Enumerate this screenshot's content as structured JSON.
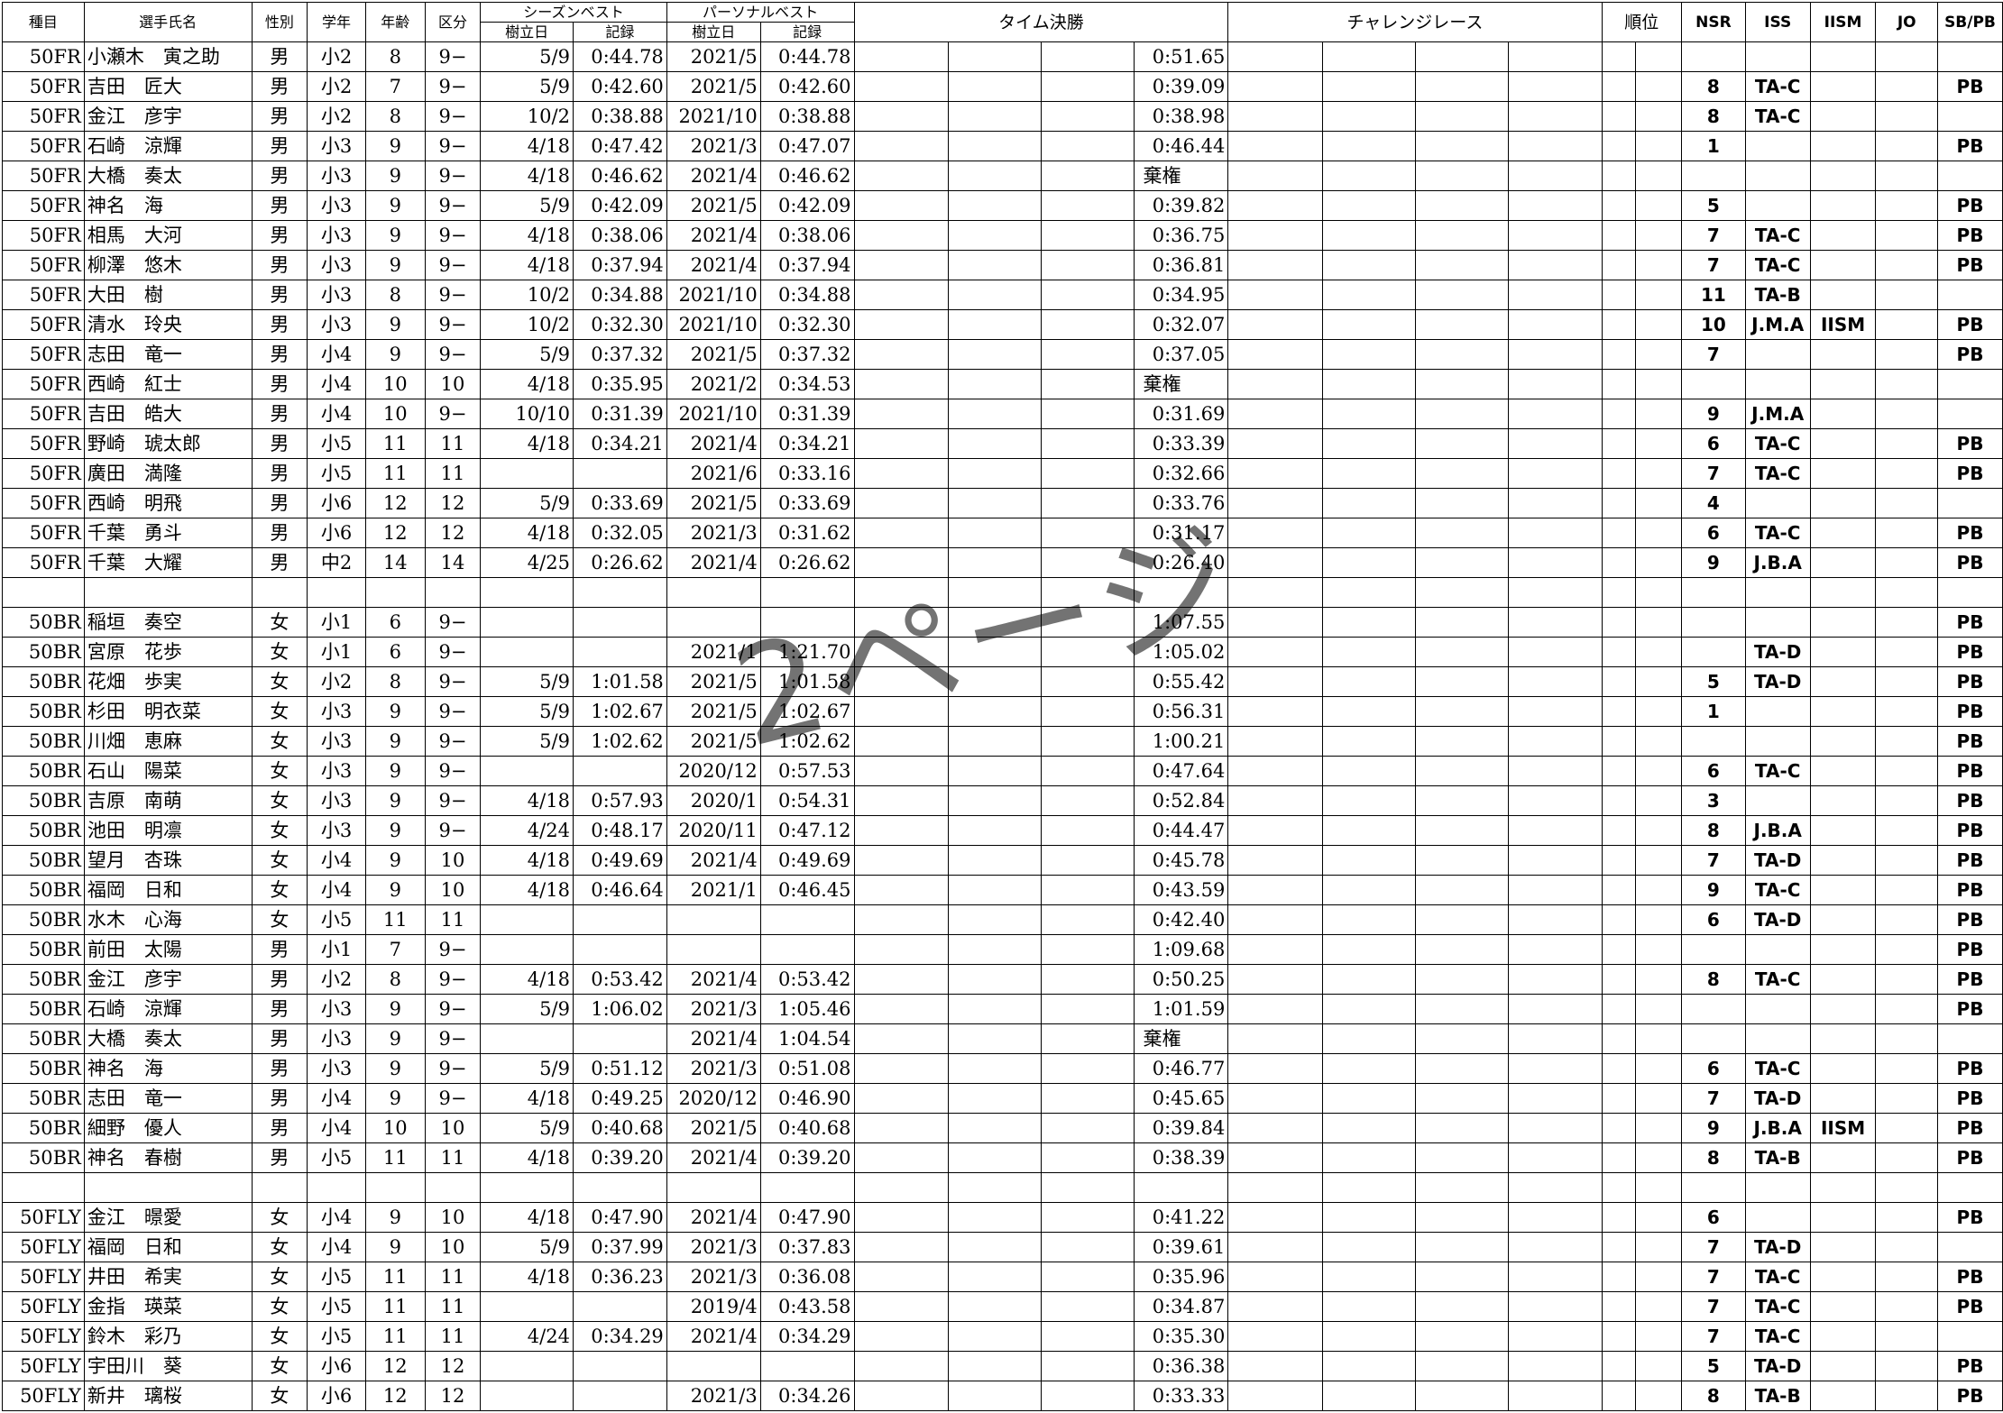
{
  "headers": {
    "event": "種目",
    "name": "選手氏名",
    "gender": "性別",
    "grade": "学年",
    "age": "年齢",
    "division": "区分",
    "season_best": "シーズンベスト",
    "personal_best": "パーソナルベスト",
    "date_set": "樹立日",
    "record": "記録",
    "time_final": "タイム決勝",
    "challenge_race": "チャレンジレース",
    "rank": "順位",
    "nsr": "NSR",
    "iss": "ISS",
    "iism": "IISM",
    "jo": "JO",
    "sbpb": "SB/PB"
  },
  "watermark": "2ページ",
  "rows": [
    {
      "event": "50FR",
      "name": "小瀬木　寅之助",
      "gender": "男",
      "grade": "小2",
      "age": "8",
      "div": "9−",
      "sb_date": "5/9",
      "sb": "0:44.78",
      "pb_date": "2021/5",
      "pb": "0:44.78",
      "final": "0:51.65",
      "nsr": "",
      "iss": "",
      "iism": "",
      "jo": "",
      "sbpb": ""
    },
    {
      "event": "50FR",
      "name": "吉田　匠大",
      "gender": "男",
      "grade": "小2",
      "age": "7",
      "div": "9−",
      "sb_date": "5/9",
      "sb": "0:42.60",
      "pb_date": "2021/5",
      "pb": "0:42.60",
      "final": "0:39.09",
      "nsr": "8",
      "iss": "TA-C",
      "iism": "",
      "jo": "",
      "sbpb": "PB"
    },
    {
      "event": "50FR",
      "name": "金江　彦宇",
      "gender": "男",
      "grade": "小2",
      "age": "8",
      "div": "9−",
      "sb_date": "10/2",
      "sb": "0:38.88",
      "pb_date": "2021/10",
      "pb": "0:38.88",
      "final": "0:38.98",
      "nsr": "8",
      "iss": "TA-C",
      "iism": "",
      "jo": "",
      "sbpb": ""
    },
    {
      "event": "50FR",
      "name": "石崎　涼輝",
      "gender": "男",
      "grade": "小3",
      "age": "9",
      "div": "9−",
      "sb_date": "4/18",
      "sb": "0:47.42",
      "pb_date": "2021/3",
      "pb": "0:47.07",
      "final": "0:46.44",
      "nsr": "1",
      "iss": "",
      "iism": "",
      "jo": "",
      "sbpb": "PB"
    },
    {
      "event": "50FR",
      "name": "大橋　奏太",
      "gender": "男",
      "grade": "小3",
      "age": "9",
      "div": "9−",
      "sb_date": "4/18",
      "sb": "0:46.62",
      "pb_date": "2021/4",
      "pb": "0:46.62",
      "final": "",
      "note": "棄権",
      "nsr": "",
      "iss": "",
      "iism": "",
      "jo": "",
      "sbpb": ""
    },
    {
      "event": "50FR",
      "name": "神名　海",
      "gender": "男",
      "grade": "小3",
      "age": "9",
      "div": "9−",
      "sb_date": "5/9",
      "sb": "0:42.09",
      "pb_date": "2021/5",
      "pb": "0:42.09",
      "final": "0:39.82",
      "nsr": "5",
      "iss": "",
      "iism": "",
      "jo": "",
      "sbpb": "PB"
    },
    {
      "event": "50FR",
      "name": "相馬　大河",
      "gender": "男",
      "grade": "小3",
      "age": "9",
      "div": "9−",
      "sb_date": "4/18",
      "sb": "0:38.06",
      "pb_date": "2021/4",
      "pb": "0:38.06",
      "final": "0:36.75",
      "nsr": "7",
      "iss": "TA-C",
      "iism": "",
      "jo": "",
      "sbpb": "PB"
    },
    {
      "event": "50FR",
      "name": "柳澤　悠木",
      "gender": "男",
      "grade": "小3",
      "age": "9",
      "div": "9−",
      "sb_date": "4/18",
      "sb": "0:37.94",
      "pb_date": "2021/4",
      "pb": "0:37.94",
      "final": "0:36.81",
      "nsr": "7",
      "iss": "TA-C",
      "iism": "",
      "jo": "",
      "sbpb": "PB"
    },
    {
      "event": "50FR",
      "name": "大田　樹",
      "gender": "男",
      "grade": "小3",
      "age": "8",
      "div": "9−",
      "sb_date": "10/2",
      "sb": "0:34.88",
      "pb_date": "2021/10",
      "pb": "0:34.88",
      "final": "0:34.95",
      "nsr": "11",
      "iss": "TA-B",
      "iism": "",
      "jo": "",
      "sbpb": ""
    },
    {
      "event": "50FR",
      "name": "清水　玲央",
      "gender": "男",
      "grade": "小3",
      "age": "9",
      "div": "9−",
      "sb_date": "10/2",
      "sb": "0:32.30",
      "pb_date": "2021/10",
      "pb": "0:32.30",
      "final": "0:32.07",
      "nsr": "10",
      "iss": "J.M.A",
      "iism": "IISM",
      "jo": "",
      "sbpb": "PB"
    },
    {
      "event": "50FR",
      "name": "志田　竜一",
      "gender": "男",
      "grade": "小4",
      "age": "9",
      "div": "9−",
      "sb_date": "5/9",
      "sb": "0:37.32",
      "pb_date": "2021/5",
      "pb": "0:37.32",
      "final": "0:37.05",
      "nsr": "7",
      "iss": "",
      "iism": "",
      "jo": "",
      "sbpb": "PB"
    },
    {
      "event": "50FR",
      "name": "西崎　紅士",
      "gender": "男",
      "grade": "小4",
      "age": "10",
      "div": "10",
      "sb_date": "4/18",
      "sb": "0:35.95",
      "pb_date": "2021/2",
      "pb": "0:34.53",
      "final": "",
      "note": "棄権",
      "nsr": "",
      "iss": "",
      "iism": "",
      "jo": "",
      "sbpb": ""
    },
    {
      "event": "50FR",
      "name": "吉田　皓大",
      "gender": "男",
      "grade": "小4",
      "age": "10",
      "div": "9−",
      "sb_date": "10/10",
      "sb": "0:31.39",
      "pb_date": "2021/10",
      "pb": "0:31.39",
      "final": "0:31.69",
      "nsr": "9",
      "iss": "J.M.A",
      "iism": "",
      "jo": "",
      "sbpb": ""
    },
    {
      "event": "50FR",
      "name": "野崎　琥太郎",
      "gender": "男",
      "grade": "小5",
      "age": "11",
      "div": "11",
      "sb_date": "4/18",
      "sb": "0:34.21",
      "pb_date": "2021/4",
      "pb": "0:34.21",
      "final": "0:33.39",
      "nsr": "6",
      "iss": "TA-C",
      "iism": "",
      "jo": "",
      "sbpb": "PB"
    },
    {
      "event": "50FR",
      "name": "廣田　満隆",
      "gender": "男",
      "grade": "小5",
      "age": "11",
      "div": "11",
      "sb_date": "",
      "sb": "",
      "pb_date": "2021/6",
      "pb": "0:33.16",
      "final": "0:32.66",
      "nsr": "7",
      "iss": "TA-C",
      "iism": "",
      "jo": "",
      "sbpb": "PB"
    },
    {
      "event": "50FR",
      "name": "西崎　明飛",
      "gender": "男",
      "grade": "小6",
      "age": "12",
      "div": "12",
      "sb_date": "5/9",
      "sb": "0:33.69",
      "pb_date": "2021/5",
      "pb": "0:33.69",
      "final": "0:33.76",
      "nsr": "4",
      "iss": "",
      "iism": "",
      "jo": "",
      "sbpb": ""
    },
    {
      "event": "50FR",
      "name": "千葉　勇斗",
      "gender": "男",
      "grade": "小6",
      "age": "12",
      "div": "12",
      "sb_date": "4/18",
      "sb": "0:32.05",
      "pb_date": "2021/3",
      "pb": "0:31.62",
      "final": "0:31.17",
      "nsr": "6",
      "iss": "TA-C",
      "iism": "",
      "jo": "",
      "sbpb": "PB"
    },
    {
      "event": "50FR",
      "name": "千葉　大耀",
      "gender": "男",
      "grade": "中2",
      "age": "14",
      "div": "14",
      "sb_date": "4/25",
      "sb": "0:26.62",
      "pb_date": "2021/4",
      "pb": "0:26.62",
      "final": "0:26.40",
      "nsr": "9",
      "iss": "J.B.A",
      "iism": "",
      "jo": "",
      "sbpb": "PB"
    },
    {
      "blank": true
    },
    {
      "event": "50BR",
      "name": "稲垣　奏空",
      "gender": "女",
      "grade": "小1",
      "age": "6",
      "div": "9−",
      "sb_date": "",
      "sb": "",
      "pb_date": "",
      "pb": "",
      "final": "1:07.55",
      "nsr": "",
      "iss": "",
      "iism": "",
      "jo": "",
      "sbpb": "PB"
    },
    {
      "event": "50BR",
      "name": "宮原　花歩",
      "gender": "女",
      "grade": "小1",
      "age": "6",
      "div": "9−",
      "sb_date": "",
      "sb": "",
      "pb_date": "2021/1",
      "pb": "1:21.70",
      "final": "1:05.02",
      "nsr": "",
      "iss": "TA-D",
      "iism": "",
      "jo": "",
      "sbpb": "PB"
    },
    {
      "event": "50BR",
      "name": "花畑　歩実",
      "gender": "女",
      "grade": "小2",
      "age": "8",
      "div": "9−",
      "sb_date": "5/9",
      "sb": "1:01.58",
      "pb_date": "2021/5",
      "pb": "1:01.58",
      "final": "0:55.42",
      "nsr": "5",
      "iss": "TA-D",
      "iism": "",
      "jo": "",
      "sbpb": "PB"
    },
    {
      "event": "50BR",
      "name": "杉田　明衣菜",
      "gender": "女",
      "grade": "小3",
      "age": "9",
      "div": "9−",
      "sb_date": "5/9",
      "sb": "1:02.67",
      "pb_date": "2021/5",
      "pb": "1:02.67",
      "final": "0:56.31",
      "nsr": "1",
      "iss": "",
      "iism": "",
      "jo": "",
      "sbpb": "PB"
    },
    {
      "event": "50BR",
      "name": "川畑　恵麻",
      "gender": "女",
      "grade": "小3",
      "age": "9",
      "div": "9−",
      "sb_date": "5/9",
      "sb": "1:02.62",
      "pb_date": "2021/5",
      "pb": "1:02.62",
      "final": "1:00.21",
      "nsr": "",
      "iss": "",
      "iism": "",
      "jo": "",
      "sbpb": "PB"
    },
    {
      "event": "50BR",
      "name": "石山　陽菜",
      "gender": "女",
      "grade": "小3",
      "age": "9",
      "div": "9−",
      "sb_date": "",
      "sb": "",
      "pb_date": "2020/12",
      "pb": "0:57.53",
      "final": "0:47.64",
      "nsr": "6",
      "iss": "TA-C",
      "iism": "",
      "jo": "",
      "sbpb": "PB"
    },
    {
      "event": "50BR",
      "name": "吉原　南萌",
      "gender": "女",
      "grade": "小3",
      "age": "9",
      "div": "9−",
      "sb_date": "4/18",
      "sb": "0:57.93",
      "pb_date": "2020/1",
      "pb": "0:54.31",
      "final": "0:52.84",
      "nsr": "3",
      "iss": "",
      "iism": "",
      "jo": "",
      "sbpb": "PB"
    },
    {
      "event": "50BR",
      "name": "池田　明凛",
      "gender": "女",
      "grade": "小3",
      "age": "9",
      "div": "9−",
      "sb_date": "4/24",
      "sb": "0:48.17",
      "pb_date": "2020/11",
      "pb": "0:47.12",
      "final": "0:44.47",
      "nsr": "8",
      "iss": "J.B.A",
      "iism": "",
      "jo": "",
      "sbpb": "PB"
    },
    {
      "event": "50BR",
      "name": "望月　杏珠",
      "gender": "女",
      "grade": "小4",
      "age": "9",
      "div": "10",
      "sb_date": "4/18",
      "sb": "0:49.69",
      "pb_date": "2021/4",
      "pb": "0:49.69",
      "final": "0:45.78",
      "nsr": "7",
      "iss": "TA-D",
      "iism": "",
      "jo": "",
      "sbpb": "PB"
    },
    {
      "event": "50BR",
      "name": "福岡　日和",
      "gender": "女",
      "grade": "小4",
      "age": "9",
      "div": "10",
      "sb_date": "4/18",
      "sb": "0:46.64",
      "pb_date": "2021/1",
      "pb": "0:46.45",
      "final": "0:43.59",
      "nsr": "9",
      "iss": "TA-C",
      "iism": "",
      "jo": "",
      "sbpb": "PB"
    },
    {
      "event": "50BR",
      "name": "水木　心海",
      "gender": "女",
      "grade": "小5",
      "age": "11",
      "div": "11",
      "sb_date": "",
      "sb": "",
      "pb_date": "",
      "pb": "",
      "final": "0:42.40",
      "nsr": "6",
      "iss": "TA-D",
      "iism": "",
      "jo": "",
      "sbpb": "PB"
    },
    {
      "event": "50BR",
      "name": "前田　太陽",
      "gender": "男",
      "grade": "小1",
      "age": "7",
      "div": "9−",
      "sb_date": "",
      "sb": "",
      "pb_date": "",
      "pb": "",
      "final": "1:09.68",
      "nsr": "",
      "iss": "",
      "iism": "",
      "jo": "",
      "sbpb": "PB"
    },
    {
      "event": "50BR",
      "name": "金江　彦宇",
      "gender": "男",
      "grade": "小2",
      "age": "8",
      "div": "9−",
      "sb_date": "4/18",
      "sb": "0:53.42",
      "pb_date": "2021/4",
      "pb": "0:53.42",
      "final": "0:50.25",
      "nsr": "8",
      "iss": "TA-C",
      "iism": "",
      "jo": "",
      "sbpb": "PB"
    },
    {
      "event": "50BR",
      "name": "石崎　涼輝",
      "gender": "男",
      "grade": "小3",
      "age": "9",
      "div": "9−",
      "sb_date": "5/9",
      "sb": "1:06.02",
      "pb_date": "2021/3",
      "pb": "1:05.46",
      "final": "1:01.59",
      "nsr": "",
      "iss": "",
      "iism": "",
      "jo": "",
      "sbpb": "PB"
    },
    {
      "event": "50BR",
      "name": "大橋　奏太",
      "gender": "男",
      "grade": "小3",
      "age": "9",
      "div": "9−",
      "sb_date": "",
      "sb": "",
      "pb_date": "2021/4",
      "pb": "1:04.54",
      "final": "",
      "note": "棄権",
      "nsr": "",
      "iss": "",
      "iism": "",
      "jo": "",
      "sbpb": ""
    },
    {
      "event": "50BR",
      "name": "神名　海",
      "gender": "男",
      "grade": "小3",
      "age": "9",
      "div": "9−",
      "sb_date": "5/9",
      "sb": "0:51.12",
      "pb_date": "2021/3",
      "pb": "0:51.08",
      "final": "0:46.77",
      "nsr": "6",
      "iss": "TA-C",
      "iism": "",
      "jo": "",
      "sbpb": "PB"
    },
    {
      "event": "50BR",
      "name": "志田　竜一",
      "gender": "男",
      "grade": "小4",
      "age": "9",
      "div": "9−",
      "sb_date": "4/18",
      "sb": "0:49.25",
      "pb_date": "2020/12",
      "pb": "0:46.90",
      "final": "0:45.65",
      "nsr": "7",
      "iss": "TA-D",
      "iism": "",
      "jo": "",
      "sbpb": "PB"
    },
    {
      "event": "50BR",
      "name": "細野　優人",
      "gender": "男",
      "grade": "小4",
      "age": "10",
      "div": "10",
      "sb_date": "5/9",
      "sb": "0:40.68",
      "pb_date": "2021/5",
      "pb": "0:40.68",
      "final": "0:39.84",
      "nsr": "9",
      "iss": "J.B.A",
      "iism": "IISM",
      "jo": "",
      "sbpb": "PB"
    },
    {
      "event": "50BR",
      "name": "神名　春樹",
      "gender": "男",
      "grade": "小5",
      "age": "11",
      "div": "11",
      "sb_date": "4/18",
      "sb": "0:39.20",
      "pb_date": "2021/4",
      "pb": "0:39.20",
      "final": "0:38.39",
      "nsr": "8",
      "iss": "TA-B",
      "iism": "",
      "jo": "",
      "sbpb": "PB"
    },
    {
      "blank": true
    },
    {
      "event": "50FLY",
      "name": "金江　暻愛",
      "gender": "女",
      "grade": "小4",
      "age": "9",
      "div": "10",
      "sb_date": "4/18",
      "sb": "0:47.90",
      "pb_date": "2021/4",
      "pb": "0:47.90",
      "final": "0:41.22",
      "nsr": "6",
      "iss": "",
      "iism": "",
      "jo": "",
      "sbpb": "PB"
    },
    {
      "event": "50FLY",
      "name": "福岡　日和",
      "gender": "女",
      "grade": "小4",
      "age": "9",
      "div": "10",
      "sb_date": "5/9",
      "sb": "0:37.99",
      "pb_date": "2021/3",
      "pb": "0:37.83",
      "final": "0:39.61",
      "nsr": "7",
      "iss": "TA-D",
      "iism": "",
      "jo": "",
      "sbpb": ""
    },
    {
      "event": "50FLY",
      "name": "井田　希実",
      "gender": "女",
      "grade": "小5",
      "age": "11",
      "div": "11",
      "sb_date": "4/18",
      "sb": "0:36.23",
      "pb_date": "2021/3",
      "pb": "0:36.08",
      "final": "0:35.96",
      "nsr": "7",
      "iss": "TA-C",
      "iism": "",
      "jo": "",
      "sbpb": "PB"
    },
    {
      "event": "50FLY",
      "name": "金指　瑛菜",
      "gender": "女",
      "grade": "小5",
      "age": "11",
      "div": "11",
      "sb_date": "",
      "sb": "",
      "pb_date": "2019/4",
      "pb": "0:43.58",
      "final": "0:34.87",
      "nsr": "7",
      "iss": "TA-C",
      "iism": "",
      "jo": "",
      "sbpb": "PB"
    },
    {
      "event": "50FLY",
      "name": "鈴木　彩乃",
      "gender": "女",
      "grade": "小5",
      "age": "11",
      "div": "11",
      "sb_date": "4/24",
      "sb": "0:34.29",
      "pb_date": "2021/4",
      "pb": "0:34.29",
      "final": "0:35.30",
      "nsr": "7",
      "iss": "TA-C",
      "iism": "",
      "jo": "",
      "sbpb": ""
    },
    {
      "event": "50FLY",
      "name": "宇田川　葵",
      "gender": "女",
      "grade": "小6",
      "age": "12",
      "div": "12",
      "sb_date": "",
      "sb": "",
      "pb_date": "",
      "pb": "",
      "final": "0:36.38",
      "nsr": "5",
      "iss": "TA-D",
      "iism": "",
      "jo": "",
      "sbpb": "PB"
    },
    {
      "event": "50FLY",
      "name": "新井　璃桜",
      "gender": "女",
      "grade": "小6",
      "age": "12",
      "div": "12",
      "sb_date": "",
      "sb": "",
      "pb_date": "2021/3",
      "pb": "0:34.26",
      "final": "0:33.33",
      "nsr": "8",
      "iss": "TA-B",
      "iism": "",
      "jo": "",
      "sbpb": "PB"
    }
  ]
}
